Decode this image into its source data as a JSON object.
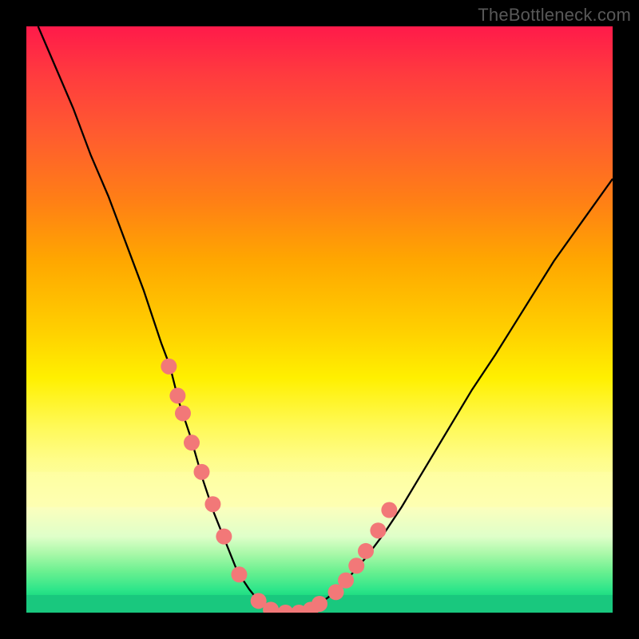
{
  "attribution": "TheBottleneck.com",
  "chart_data": {
    "type": "line",
    "title": "",
    "xlabel": "",
    "ylabel": "",
    "xlim": [
      0,
      100
    ],
    "ylim": [
      0,
      100
    ],
    "series": [
      {
        "name": "bottleneck-curve",
        "color": "#000000",
        "x": [
          2,
          5,
          8,
          11,
          14,
          17,
          20,
          23,
          24.5,
          26,
          28,
          30,
          32,
          34,
          36,
          38,
          40,
          42,
          44,
          46,
          48,
          50,
          52,
          55,
          58,
          61,
          64,
          67,
          70,
          73,
          76,
          80,
          85,
          90,
          95,
          100
        ],
        "y": [
          100,
          93,
          86,
          78,
          71,
          63,
          55,
          46,
          42,
          36,
          30,
          23,
          17,
          12,
          7,
          4,
          1.5,
          0.5,
          0,
          0,
          0.5,
          1.5,
          3,
          6,
          9.5,
          13.5,
          18,
          23,
          28,
          33,
          38,
          44,
          52,
          60,
          67,
          74
        ]
      }
    ],
    "points": {
      "name": "highlight-dots",
      "color": "#f27878",
      "radius": 10,
      "x": [
        24.3,
        25.8,
        26.7,
        28.2,
        29.9,
        31.8,
        33.7,
        36.3,
        39.6,
        41.7,
        44.2,
        46.5,
        48.5,
        50.0,
        52.8,
        54.5,
        56.3,
        57.9,
        60.0,
        61.9
      ],
      "y": [
        42,
        37,
        34,
        29,
        24,
        18.5,
        13,
        6.5,
        2,
        0.5,
        0,
        0,
        0.5,
        1.5,
        3.5,
        5.5,
        8,
        10.5,
        14,
        17.5
      ]
    },
    "bottom_strip": {
      "y_min": 0,
      "y_max": 3,
      "color": "#19c87e"
    },
    "band_strip": {
      "y_min": 18,
      "y_max": 24,
      "color": "#ffffaa"
    }
  }
}
